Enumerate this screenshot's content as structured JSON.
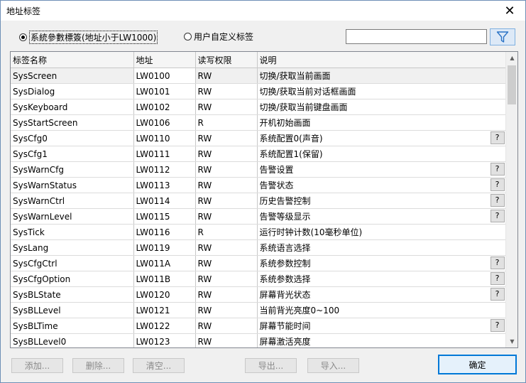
{
  "window": {
    "title": "地址标签",
    "close_glyph": "✕"
  },
  "radios": {
    "system": {
      "label": "系統參數標簽(地址小于LW1000)",
      "checked": true
    },
    "user": {
      "label": "用户自定义标签",
      "checked": false
    }
  },
  "search": {
    "value": "",
    "placeholder": ""
  },
  "table": {
    "headers": [
      "标签名称",
      "地址",
      "读写权限",
      "说明"
    ],
    "rows": [
      {
        "name": "SysScreen",
        "addr": "LW0100",
        "rw": "RW",
        "desc": "切换/获取当前画面",
        "help": false
      },
      {
        "name": "SysDialog",
        "addr": "LW0101",
        "rw": "RW",
        "desc": "切换/获取当前对话框画面",
        "help": false
      },
      {
        "name": "SysKeyboard",
        "addr": "LW0102",
        "rw": "RW",
        "desc": "切换/获取当前键盘画面",
        "help": false
      },
      {
        "name": "SysStartScreen",
        "addr": "LW0106",
        "rw": "R",
        "desc": "开机初始画面",
        "help": false
      },
      {
        "name": "SysCfg0",
        "addr": "LW0110",
        "rw": "RW",
        "desc": "系统配置0(声音)",
        "help": true
      },
      {
        "name": "SysCfg1",
        "addr": "LW0111",
        "rw": "RW",
        "desc": "系统配置1(保留)",
        "help": false
      },
      {
        "name": "SysWarnCfg",
        "addr": "LW0112",
        "rw": "RW",
        "desc": "告警设置",
        "help": true
      },
      {
        "name": "SysWarnStatus",
        "addr": "LW0113",
        "rw": "RW",
        "desc": "告警状态",
        "help": true
      },
      {
        "name": "SysWarnCtrl",
        "addr": "LW0114",
        "rw": "RW",
        "desc": "历史告警控制",
        "help": true
      },
      {
        "name": "SysWarnLevel",
        "addr": "LW0115",
        "rw": "RW",
        "desc": "告警等级显示",
        "help": true
      },
      {
        "name": "SysTick",
        "addr": "LW0116",
        "rw": "R",
        "desc": "运行时钟计数(10毫秒单位)",
        "help": false
      },
      {
        "name": "SysLang",
        "addr": "LW0119",
        "rw": "RW",
        "desc": "系统语言选择",
        "help": false
      },
      {
        "name": "SysCfgCtrl",
        "addr": "LW011A",
        "rw": "RW",
        "desc": "系统参数控制",
        "help": true
      },
      {
        "name": "SysCfgOption",
        "addr": "LW011B",
        "rw": "RW",
        "desc": "系统参数选择",
        "help": true
      },
      {
        "name": "SysBLState",
        "addr": "LW0120",
        "rw": "RW",
        "desc": "屏幕背光状态",
        "help": true
      },
      {
        "name": "SysBLLevel",
        "addr": "LW0121",
        "rw": "RW",
        "desc": "当前背光亮度0~100",
        "help": false
      },
      {
        "name": "SysBLTime",
        "addr": "LW0122",
        "rw": "RW",
        "desc": "屏幕节能时间",
        "help": true
      },
      {
        "name": "SysBLLevel0",
        "addr": "LW0123",
        "rw": "RW",
        "desc": "屏幕激活亮度",
        "help": false
      }
    ],
    "help_label": "?"
  },
  "buttons": {
    "add": "添加...",
    "delete": "删除...",
    "clear": "清空...",
    "export": "导出...",
    "import": "导入...",
    "ok": "确定"
  },
  "icons": {
    "filter": "funnel-icon",
    "close": "close-icon",
    "scroll_up": "scroll-up-arrow",
    "scroll_down": "scroll-down-arrow"
  },
  "colors": {
    "accent": "#0078d7",
    "filter_icon": "#2a72c5"
  }
}
